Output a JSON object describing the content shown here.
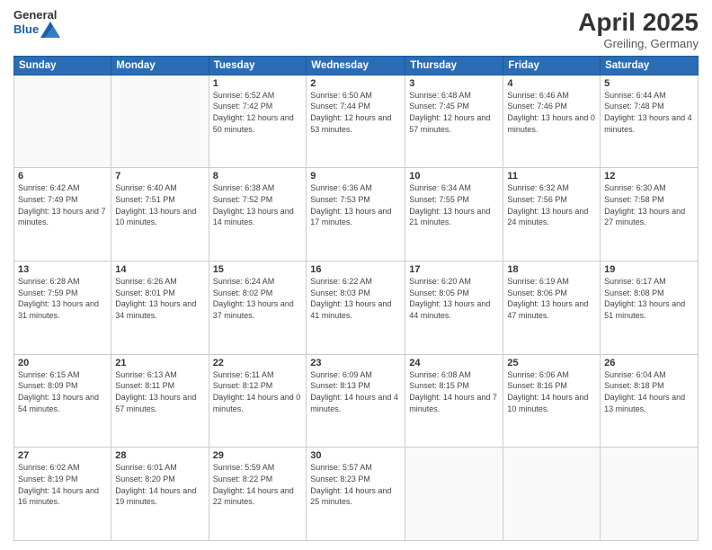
{
  "header": {
    "logo_general": "General",
    "logo_blue": "Blue",
    "month_title": "April 2025",
    "location": "Greiling, Germany"
  },
  "days_of_week": [
    "Sunday",
    "Monday",
    "Tuesday",
    "Wednesday",
    "Thursday",
    "Friday",
    "Saturday"
  ],
  "weeks": [
    [
      {
        "day": "",
        "info": ""
      },
      {
        "day": "",
        "info": ""
      },
      {
        "day": "1",
        "info": "Sunrise: 6:52 AM\nSunset: 7:42 PM\nDaylight: 12 hours and 50 minutes."
      },
      {
        "day": "2",
        "info": "Sunrise: 6:50 AM\nSunset: 7:44 PM\nDaylight: 12 hours and 53 minutes."
      },
      {
        "day": "3",
        "info": "Sunrise: 6:48 AM\nSunset: 7:45 PM\nDaylight: 12 hours and 57 minutes."
      },
      {
        "day": "4",
        "info": "Sunrise: 6:46 AM\nSunset: 7:46 PM\nDaylight: 13 hours and 0 minutes."
      },
      {
        "day": "5",
        "info": "Sunrise: 6:44 AM\nSunset: 7:48 PM\nDaylight: 13 hours and 4 minutes."
      }
    ],
    [
      {
        "day": "6",
        "info": "Sunrise: 6:42 AM\nSunset: 7:49 PM\nDaylight: 13 hours and 7 minutes."
      },
      {
        "day": "7",
        "info": "Sunrise: 6:40 AM\nSunset: 7:51 PM\nDaylight: 13 hours and 10 minutes."
      },
      {
        "day": "8",
        "info": "Sunrise: 6:38 AM\nSunset: 7:52 PM\nDaylight: 13 hours and 14 minutes."
      },
      {
        "day": "9",
        "info": "Sunrise: 6:36 AM\nSunset: 7:53 PM\nDaylight: 13 hours and 17 minutes."
      },
      {
        "day": "10",
        "info": "Sunrise: 6:34 AM\nSunset: 7:55 PM\nDaylight: 13 hours and 21 minutes."
      },
      {
        "day": "11",
        "info": "Sunrise: 6:32 AM\nSunset: 7:56 PM\nDaylight: 13 hours and 24 minutes."
      },
      {
        "day": "12",
        "info": "Sunrise: 6:30 AM\nSunset: 7:58 PM\nDaylight: 13 hours and 27 minutes."
      }
    ],
    [
      {
        "day": "13",
        "info": "Sunrise: 6:28 AM\nSunset: 7:59 PM\nDaylight: 13 hours and 31 minutes."
      },
      {
        "day": "14",
        "info": "Sunrise: 6:26 AM\nSunset: 8:01 PM\nDaylight: 13 hours and 34 minutes."
      },
      {
        "day": "15",
        "info": "Sunrise: 6:24 AM\nSunset: 8:02 PM\nDaylight: 13 hours and 37 minutes."
      },
      {
        "day": "16",
        "info": "Sunrise: 6:22 AM\nSunset: 8:03 PM\nDaylight: 13 hours and 41 minutes."
      },
      {
        "day": "17",
        "info": "Sunrise: 6:20 AM\nSunset: 8:05 PM\nDaylight: 13 hours and 44 minutes."
      },
      {
        "day": "18",
        "info": "Sunrise: 6:19 AM\nSunset: 8:06 PM\nDaylight: 13 hours and 47 minutes."
      },
      {
        "day": "19",
        "info": "Sunrise: 6:17 AM\nSunset: 8:08 PM\nDaylight: 13 hours and 51 minutes."
      }
    ],
    [
      {
        "day": "20",
        "info": "Sunrise: 6:15 AM\nSunset: 8:09 PM\nDaylight: 13 hours and 54 minutes."
      },
      {
        "day": "21",
        "info": "Sunrise: 6:13 AM\nSunset: 8:11 PM\nDaylight: 13 hours and 57 minutes."
      },
      {
        "day": "22",
        "info": "Sunrise: 6:11 AM\nSunset: 8:12 PM\nDaylight: 14 hours and 0 minutes."
      },
      {
        "day": "23",
        "info": "Sunrise: 6:09 AM\nSunset: 8:13 PM\nDaylight: 14 hours and 4 minutes."
      },
      {
        "day": "24",
        "info": "Sunrise: 6:08 AM\nSunset: 8:15 PM\nDaylight: 14 hours and 7 minutes."
      },
      {
        "day": "25",
        "info": "Sunrise: 6:06 AM\nSunset: 8:16 PM\nDaylight: 14 hours and 10 minutes."
      },
      {
        "day": "26",
        "info": "Sunrise: 6:04 AM\nSunset: 8:18 PM\nDaylight: 14 hours and 13 minutes."
      }
    ],
    [
      {
        "day": "27",
        "info": "Sunrise: 6:02 AM\nSunset: 8:19 PM\nDaylight: 14 hours and 16 minutes."
      },
      {
        "day": "28",
        "info": "Sunrise: 6:01 AM\nSunset: 8:20 PM\nDaylight: 14 hours and 19 minutes."
      },
      {
        "day": "29",
        "info": "Sunrise: 5:59 AM\nSunset: 8:22 PM\nDaylight: 14 hours and 22 minutes."
      },
      {
        "day": "30",
        "info": "Sunrise: 5:57 AM\nSunset: 8:23 PM\nDaylight: 14 hours and 25 minutes."
      },
      {
        "day": "",
        "info": ""
      },
      {
        "day": "",
        "info": ""
      },
      {
        "day": "",
        "info": ""
      }
    ]
  ]
}
